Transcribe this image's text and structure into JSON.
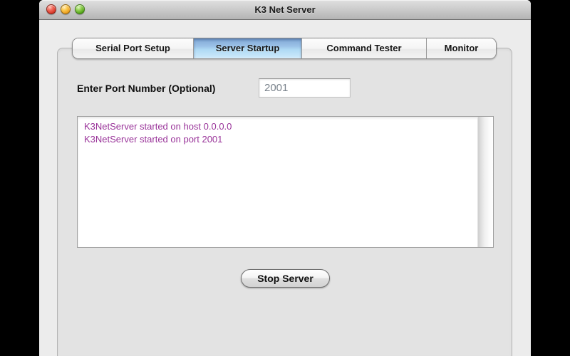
{
  "window": {
    "title": "K3 Net Server"
  },
  "tabs": {
    "items": [
      {
        "label": "Serial Port Setup",
        "selected": false
      },
      {
        "label": "Server Startup",
        "selected": true
      },
      {
        "label": "Command Tester",
        "selected": false
      },
      {
        "label": "Monitor",
        "selected": false
      }
    ]
  },
  "port_field": {
    "label": "Enter Port Number (Optional)",
    "value": "2001"
  },
  "log": {
    "lines": [
      "K3NetServer started on host 0.0.0.0",
      "K3NetServer started on port 2001"
    ],
    "text_color": "#993399"
  },
  "actions": {
    "stop_server_label": "Stop Server"
  },
  "icons": {
    "close": "close-icon",
    "minimize": "minimize-icon",
    "zoom": "zoom-icon"
  },
  "colors": {
    "selected_tab_top": "#7fa6d4",
    "selected_tab_bottom": "#cfeafb",
    "window_background": "#ececec",
    "box_background": "#e3e3e3",
    "log_text": "#993399"
  }
}
